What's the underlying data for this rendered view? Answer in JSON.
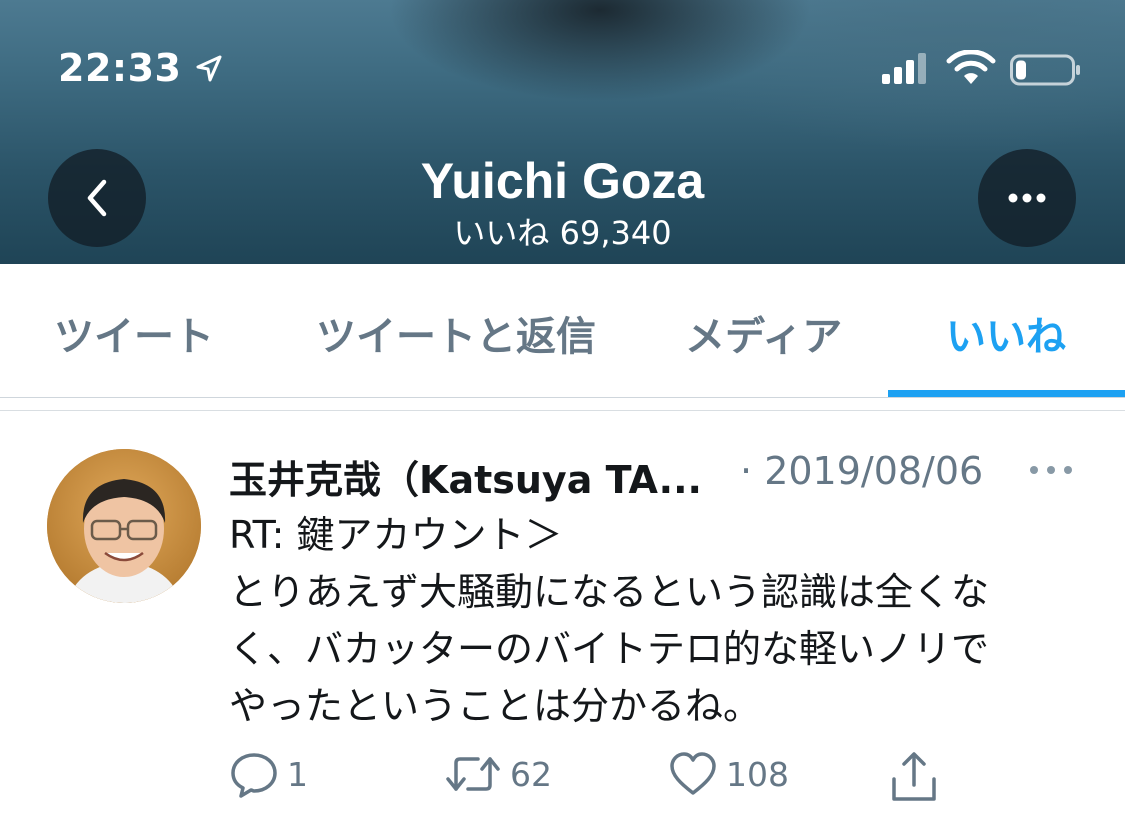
{
  "status_bar": {
    "time": "22:33"
  },
  "header": {
    "name": "Yuichi Goza",
    "likes_count": "いいね 69,340"
  },
  "tabs": [
    {
      "label": "ツイート",
      "active": false
    },
    {
      "label": "ツイートと返信",
      "active": false
    },
    {
      "label": "メディア",
      "active": false
    },
    {
      "label": "いいね",
      "active": true
    }
  ],
  "colors": {
    "accent": "#1da1f2",
    "secondary_text": "#657786",
    "primary_text": "#14171a"
  },
  "tweet": {
    "author": "玉井克哉（Katsuya TA...",
    "separator": "·",
    "date": "2019/08/06",
    "lines": [
      "RT: 鍵アカウント＞",
      "とりあえず大騒動になるという認識は全くな",
      "く、バカッターのバイトテロ的な軽いノリで",
      "やったということは分かるね。"
    ],
    "reply_count": "1",
    "retweet_count": "62",
    "like_count": "108"
  },
  "icons": [
    "location-arrow-icon",
    "signal-icon",
    "wifi-icon",
    "battery-icon",
    "back-arrow-icon",
    "more-icon",
    "reply-icon",
    "retweet-icon",
    "like-icon",
    "share-icon"
  ]
}
